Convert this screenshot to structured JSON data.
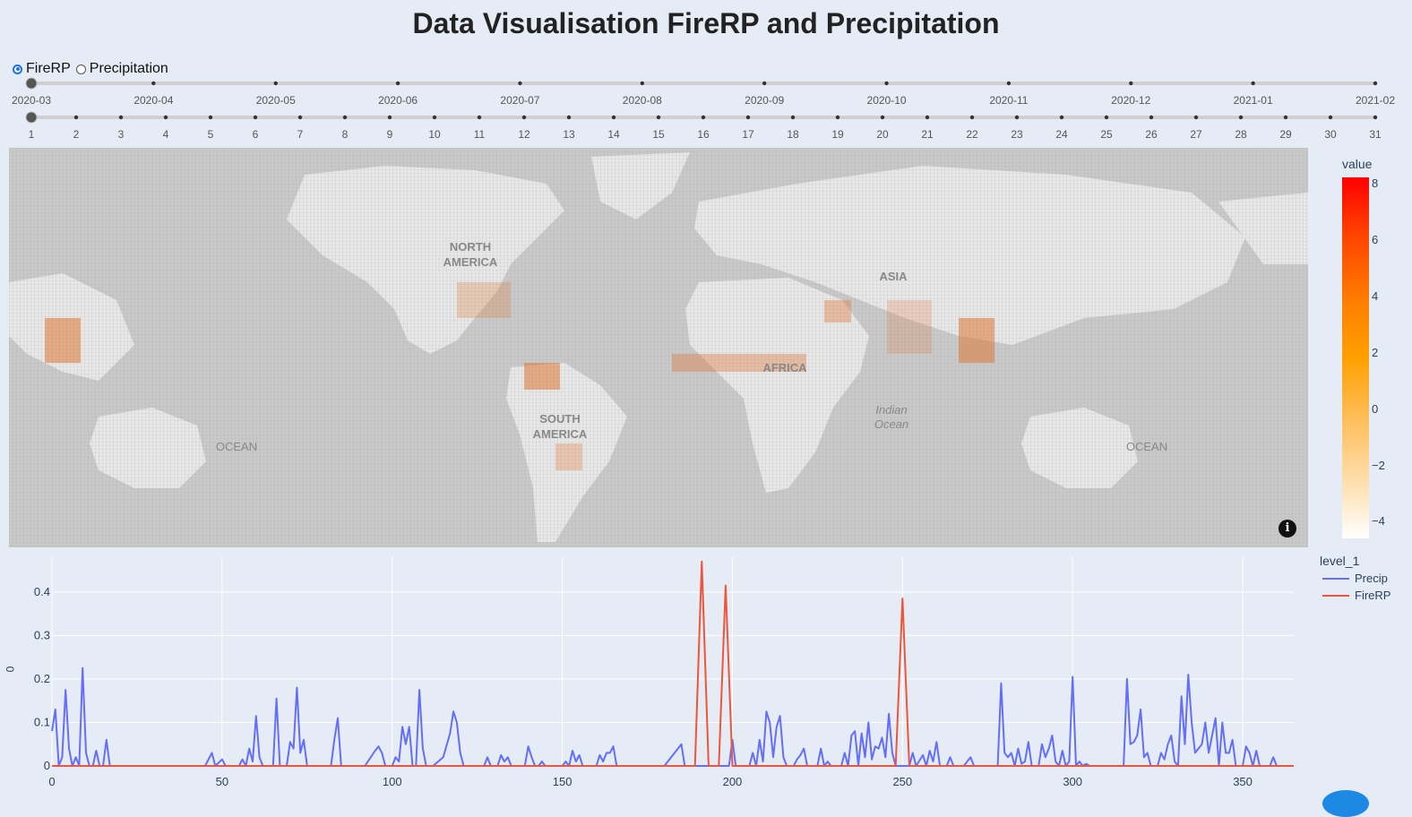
{
  "title": "Data Visualisation FireRP and Precipitation",
  "radio": {
    "options": [
      {
        "label": "FireRP",
        "checked": true
      },
      {
        "label": "Precipitation",
        "checked": false
      }
    ]
  },
  "month_slider": {
    "labels": [
      "2020-03",
      "2020-04",
      "2020-05",
      "2020-06",
      "2020-07",
      "2020-08",
      "2020-09",
      "2020-10",
      "2020-11",
      "2020-12",
      "2021-01",
      "2021-02"
    ],
    "selected_index": 0
  },
  "day_slider": {
    "labels": [
      "1",
      "2",
      "3",
      "4",
      "5",
      "6",
      "7",
      "8",
      "9",
      "10",
      "11",
      "12",
      "13",
      "14",
      "15",
      "16",
      "17",
      "18",
      "19",
      "20",
      "21",
      "22",
      "23",
      "24",
      "25",
      "26",
      "27",
      "28",
      "29",
      "30",
      "31"
    ],
    "selected_index": 0
  },
  "map": {
    "labels": {
      "north_america": [
        "NORTH",
        "AMERICA"
      ],
      "south_america": [
        "SOUTH",
        "AMERICA"
      ],
      "africa": "AFRICA",
      "asia": "ASIA",
      "indian_ocean": [
        "Indian",
        "Ocean"
      ],
      "ocean_left": "OCEAN",
      "ocean_right": "OCEAN"
    },
    "info_glyph": "i"
  },
  "colorbar": {
    "title": "value",
    "ticks": [
      "8",
      "6",
      "4",
      "2",
      "0",
      "−2",
      "−4"
    ],
    "colors": [
      "#ff0000",
      "#ff8000",
      "#ffc060",
      "#ffffff"
    ]
  },
  "chart_data": {
    "type": "line",
    "xlim": [
      0,
      365
    ],
    "ylim": [
      0,
      0.48
    ],
    "xticks": [
      0,
      50,
      100,
      150,
      200,
      250,
      300,
      350
    ],
    "yticks": [
      0,
      0.1,
      0.2,
      0.3,
      0.4
    ],
    "ytick_labels": [
      "0",
      "0.1",
      "0.2",
      "0.3",
      "0.4"
    ],
    "ylabel": "0",
    "legend_title": "level_1",
    "grid": true,
    "series": [
      {
        "name": "Precip",
        "color": "#636efa",
        "points": [
          [
            0,
            0.08
          ],
          [
            1,
            0.13
          ],
          [
            2,
            0
          ],
          [
            3,
            0.02
          ],
          [
            4,
            0.175
          ],
          [
            5,
            0.04
          ],
          [
            6,
            0
          ],
          [
            7,
            0.02
          ],
          [
            8,
            0
          ],
          [
            9,
            0.225
          ],
          [
            10,
            0.03
          ],
          [
            11,
            0
          ],
          [
            12,
            0
          ],
          [
            13,
            0.035
          ],
          [
            14,
            0
          ],
          [
            15,
            0
          ],
          [
            16,
            0.06
          ],
          [
            17,
            0
          ],
          [
            45,
            0
          ],
          [
            47,
            0.03
          ],
          [
            48,
            0
          ],
          [
            50,
            0.015
          ],
          [
            51,
            0
          ],
          [
            55,
            0
          ],
          [
            56,
            0.015
          ],
          [
            57,
            0
          ],
          [
            58,
            0.04
          ],
          [
            59,
            0.01
          ],
          [
            60,
            0.115
          ],
          [
            61,
            0.02
          ],
          [
            62,
            0
          ],
          [
            65,
            0
          ],
          [
            66,
            0.155
          ],
          [
            67,
            0
          ],
          [
            69,
            0
          ],
          [
            70,
            0.055
          ],
          [
            71,
            0.04
          ],
          [
            72,
            0.18
          ],
          [
            73,
            0.03
          ],
          [
            74,
            0.06
          ],
          [
            75,
            0
          ],
          [
            82,
            0
          ],
          [
            83,
            0.06
          ],
          [
            84,
            0.11
          ],
          [
            85,
            0
          ],
          [
            92,
            0
          ],
          [
            95,
            0.035
          ],
          [
            96,
            0.045
          ],
          [
            97,
            0.03
          ],
          [
            98,
            0
          ],
          [
            100,
            0
          ],
          [
            101,
            0.02
          ],
          [
            102,
            0.01
          ],
          [
            103,
            0.09
          ],
          [
            104,
            0.05
          ],
          [
            105,
            0.09
          ],
          [
            106,
            0
          ],
          [
            107,
            0
          ],
          [
            108,
            0.175
          ],
          [
            109,
            0.04
          ],
          [
            110,
            0
          ],
          [
            112,
            0
          ],
          [
            115,
            0.02
          ],
          [
            117,
            0.075
          ],
          [
            118,
            0.125
          ],
          [
            119,
            0.1
          ],
          [
            120,
            0.03
          ],
          [
            121,
            0
          ],
          [
            127,
            0
          ],
          [
            128,
            0.02
          ],
          [
            129,
            0
          ],
          [
            131,
            0
          ],
          [
            132,
            0.025
          ],
          [
            133,
            0.01
          ],
          [
            134,
            0.02
          ],
          [
            135,
            0
          ],
          [
            139,
            0
          ],
          [
            140,
            0.045
          ],
          [
            141,
            0.02
          ],
          [
            142,
            0
          ],
          [
            143,
            0
          ],
          [
            144,
            0.01
          ],
          [
            145,
            0
          ],
          [
            150,
            0
          ],
          [
            151,
            0.01
          ],
          [
            152,
            0
          ],
          [
            153,
            0.035
          ],
          [
            154,
            0.01
          ],
          [
            155,
            0.025
          ],
          [
            156,
            0
          ],
          [
            160,
            0
          ],
          [
            161,
            0.025
          ],
          [
            162,
            0.01
          ],
          [
            163,
            0.03
          ],
          [
            164,
            0.03
          ],
          [
            165,
            0.045
          ],
          [
            166,
            0
          ],
          [
            180,
            0
          ],
          [
            184,
            0.04
          ],
          [
            185,
            0.05
          ],
          [
            186,
            0
          ],
          [
            190,
            0
          ],
          [
            199,
            0
          ],
          [
            200,
            0.06
          ],
          [
            201,
            0
          ],
          [
            205,
            0
          ],
          [
            206,
            0.03
          ],
          [
            207,
            0
          ],
          [
            208,
            0.06
          ],
          [
            209,
            0.01
          ],
          [
            210,
            0.125
          ],
          [
            211,
            0.1
          ],
          [
            212,
            0.02
          ],
          [
            213,
            0.09
          ],
          [
            214,
            0.115
          ],
          [
            215,
            0.02
          ],
          [
            216,
            0
          ],
          [
            218,
            0
          ],
          [
            219,
            0.015
          ],
          [
            220,
            0.025
          ],
          [
            221,
            0.04
          ],
          [
            222,
            0
          ],
          [
            225,
            0
          ],
          [
            226,
            0.04
          ],
          [
            227,
            0
          ],
          [
            228,
            0.01
          ],
          [
            229,
            0
          ],
          [
            232,
            0
          ],
          [
            233,
            0.03
          ],
          [
            234,
            0
          ],
          [
            235,
            0.07
          ],
          [
            236,
            0.08
          ],
          [
            237,
            0
          ],
          [
            238,
            0.075
          ],
          [
            239,
            0.02
          ],
          [
            240,
            0.1
          ],
          [
            241,
            0.015
          ],
          [
            242,
            0.045
          ],
          [
            243,
            0.04
          ],
          [
            244,
            0.065
          ],
          [
            245,
            0.02
          ],
          [
            246,
            0.12
          ],
          [
            247,
            0.03
          ],
          [
            248,
            0
          ],
          [
            252,
            0
          ],
          [
            253,
            0.03
          ],
          [
            254,
            0
          ],
          [
            256,
            0.025
          ],
          [
            257,
            0
          ],
          [
            258,
            0.035
          ],
          [
            259,
            0.01
          ],
          [
            260,
            0.055
          ],
          [
            261,
            0
          ],
          [
            263,
            0
          ],
          [
            264,
            0.02
          ],
          [
            265,
            0
          ],
          [
            268,
            0
          ],
          [
            270,
            0.02
          ],
          [
            271,
            0
          ],
          [
            278,
            0
          ],
          [
            279,
            0.19
          ],
          [
            280,
            0.03
          ],
          [
            281,
            0.02
          ],
          [
            282,
            0.03
          ],
          [
            283,
            0
          ],
          [
            284,
            0.04
          ],
          [
            285,
            0.005
          ],
          [
            286,
            0.01
          ],
          [
            287,
            0.055
          ],
          [
            288,
            0
          ],
          [
            290,
            0
          ],
          [
            291,
            0.05
          ],
          [
            292,
            0.02
          ],
          [
            293,
            0.04
          ],
          [
            294,
            0.07
          ],
          [
            295,
            0.01
          ],
          [
            296,
            0
          ],
          [
            297,
            0.035
          ],
          [
            298,
            0
          ],
          [
            299,
            0.01
          ],
          [
            300,
            0.205
          ],
          [
            301,
            0
          ],
          [
            302,
            0.01
          ],
          [
            303,
            0
          ],
          [
            304,
            0.005
          ],
          [
            305,
            0
          ],
          [
            315,
            0
          ],
          [
            316,
            0.2
          ],
          [
            317,
            0.05
          ],
          [
            318,
            0.055
          ],
          [
            319,
            0.07
          ],
          [
            320,
            0.13
          ],
          [
            321,
            0.02
          ],
          [
            322,
            0.03
          ],
          [
            323,
            0
          ],
          [
            325,
            0
          ],
          [
            326,
            0.03
          ],
          [
            327,
            0.015
          ],
          [
            328,
            0.05
          ],
          [
            329,
            0.07
          ],
          [
            330,
            0.01
          ],
          [
            331,
            0
          ],
          [
            332,
            0.16
          ],
          [
            333,
            0.05
          ],
          [
            334,
            0.21
          ],
          [
            335,
            0.1
          ],
          [
            336,
            0.03
          ],
          [
            337,
            0.04
          ],
          [
            338,
            0.05
          ],
          [
            339,
            0.1
          ],
          [
            340,
            0.03
          ],
          [
            341,
            0.07
          ],
          [
            342,
            0.11
          ],
          [
            343,
            0
          ],
          [
            344,
            0.1
          ],
          [
            345,
            0.03
          ],
          [
            346,
            0.03
          ],
          [
            347,
            0.06
          ],
          [
            348,
            0
          ],
          [
            350,
            0
          ],
          [
            351,
            0.045
          ],
          [
            352,
            0.03
          ],
          [
            353,
            0
          ],
          [
            354,
            0.035
          ],
          [
            355,
            0
          ],
          [
            358,
            0
          ],
          [
            359,
            0.02
          ],
          [
            360,
            0
          ]
        ]
      },
      {
        "name": "FireRP",
        "color": "#ef553b",
        "points": [
          [
            0,
            0
          ],
          [
            189,
            0
          ],
          [
            191,
            0.47
          ],
          [
            193,
            0
          ],
          [
            196,
            0
          ],
          [
            198,
            0.415
          ],
          [
            200,
            0
          ],
          [
            248,
            0
          ],
          [
            250,
            0.385
          ],
          [
            252,
            0
          ],
          [
            365,
            0
          ]
        ]
      }
    ]
  }
}
